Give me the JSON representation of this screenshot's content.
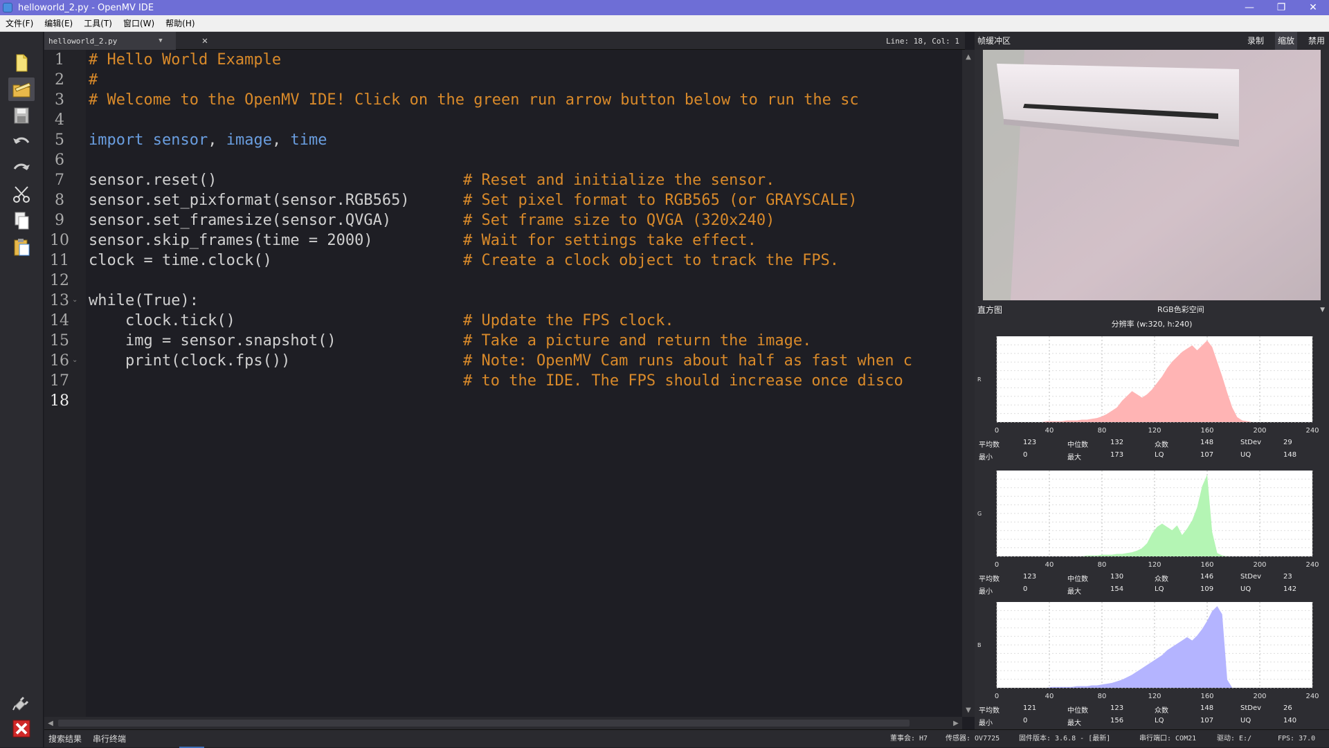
{
  "window": {
    "title": "helloworld_2.py - OpenMV IDE",
    "minimize": "—",
    "maximize": "❐",
    "close": "✕"
  },
  "menu": [
    "文件(F)",
    "编辑(E)",
    "工具(T)",
    "窗口(W)",
    "帮助(H)"
  ],
  "editor": {
    "tab_label": "helloworld_2.py",
    "cursor_position": "Line: 18, Col: 1",
    "line_numbers": [
      "1",
      "2",
      "3",
      "4",
      "5",
      "6",
      "7",
      "8",
      "9",
      "10",
      "11",
      "12",
      "13",
      "14",
      "15",
      "16",
      "17",
      "18"
    ],
    "active_line": "18",
    "code": {
      "l1": "# Hello World Example",
      "l2": "#",
      "l3": "# Welcome to the OpenMV IDE! Click on the green run arrow button below to run the sc",
      "l5_kw": "import",
      "l5_a": "sensor",
      "l5_b": "image",
      "l5_c": "time",
      "l7": "sensor.reset()",
      "l8": "sensor.set_pixformat(sensor.RGB565)",
      "l9": "sensor.set_framesize(sensor.QVGA)",
      "l10": "sensor.skip_frames(time = 2000)",
      "l11": "clock = time.clock()",
      "l13": "while(True):",
      "l14": "    clock.tick()",
      "l15": "    img = sensor.snapshot()",
      "l16": "    print(clock.fps())",
      "c7": "# Reset and initialize the sensor.",
      "c8": "# Set pixel format to RGB565 (or GRAYSCALE)",
      "c9": "# Set frame size to QVGA (320x240)",
      "c10": "# Wait for settings take effect.",
      "c11": "# Create a clock object to track the FPS.",
      "c14": "# Update the FPS clock.",
      "c15": "# Take a picture and return the image.",
      "c16": "# Note: OpenMV Cam runs about half as fast when c",
      "c17": "# to the IDE. The FPS should increase once disco"
    }
  },
  "frame_buffer": {
    "title": "帧缓冲区",
    "record": "录制",
    "zoom": "缩放",
    "disable": "禁用"
  },
  "histogram": {
    "title": "直方图",
    "color_space": "RGB色彩空间",
    "resolution": "分辨率 (w:320, h:240)",
    "ticks": [
      "0",
      "40",
      "80",
      "120",
      "160",
      "200",
      "240"
    ],
    "stat_labels": {
      "mean": "平均数",
      "median": "中位数",
      "mode": "众数",
      "stdev": "StDev",
      "min": "最小",
      "max": "最大",
      "lq": "LQ",
      "uq": "UQ"
    },
    "channels": [
      {
        "name": "R",
        "color": "#ffb4b4",
        "mean": "123",
        "median": "132",
        "mode": "148",
        "stdev": "29",
        "min": "0",
        "max": "173",
        "lq": "107",
        "uq": "148"
      },
      {
        "name": "G",
        "color": "#b4f5b4",
        "mean": "123",
        "median": "130",
        "mode": "146",
        "stdev": "23",
        "min": "0",
        "max": "154",
        "lq": "109",
        "uq": "142"
      },
      {
        "name": "B",
        "color": "#b4b4ff",
        "mean": "121",
        "median": "123",
        "mode": "148",
        "stdev": "26",
        "min": "0",
        "max": "156",
        "lq": "107",
        "uq": "140"
      }
    ]
  },
  "statusbar": {
    "search_results": "搜索结果",
    "serial_terminal": "串行终端",
    "board": "董事会: H7",
    "sensor": "传感器: OV7725",
    "firmware": "固件版本: 3.6.8 - [最新]",
    "serial_port": "串行端口: COM21",
    "drive": "驱动: E:/",
    "fps": "FPS: 37.0"
  }
}
